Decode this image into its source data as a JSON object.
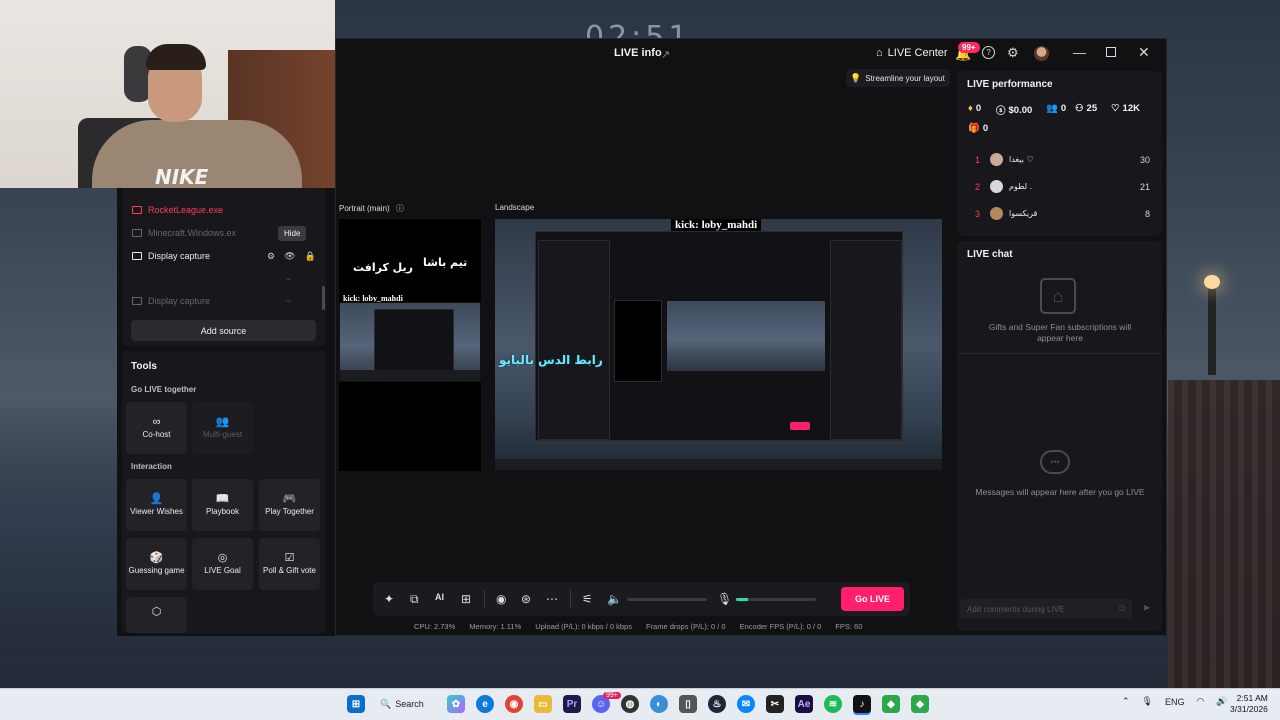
{
  "wallpaper": {
    "clock_text": "02:51"
  },
  "window": {
    "title": "LIVE info",
    "live_center_label": "LIVE Center",
    "notifications_badge": "99+",
    "tip_text": "Streamline your layout"
  },
  "sources": {
    "items": [
      {
        "label": "RocketLeague.exe",
        "state": "error"
      },
      {
        "label": "Minecraft.Windows.ex",
        "state": "hidden"
      },
      {
        "label": "Display capture",
        "state": "active"
      },
      {
        "label": "Display capture",
        "state": "hidden"
      }
    ],
    "hide_tooltip": "Hide",
    "add_source_label": "Add source"
  },
  "tools": {
    "title": "Tools",
    "go_live_together_label": "Go LIVE together",
    "cohost_label": "Co-host",
    "multiguest_label": "Multi-guest",
    "interaction_label": "Interaction",
    "viewer_wishes_label": "Viewer Wishes",
    "playbook_label": "Playbook",
    "play_together_label": "Play Together",
    "guessing_game_label": "Guessing game",
    "live_goal_label": "LIVE Goal",
    "poll_gift_label": "Poll & Gift vote"
  },
  "preview": {
    "portrait_label": "Portrait (main)",
    "landscape_label": "Landscape",
    "overlay_kick": "kick: loby_mahdi",
    "overlay_team": "تيم باشا",
    "overlay_real": "ريل كرافت",
    "overlay_link": "رابط الدس بالبايو"
  },
  "controls": {
    "go_live_label": "Go LIVE",
    "volume_level": 0,
    "mic_level": 0.15,
    "stats": {
      "cpu": "CPU:  2.73%",
      "memory": "Memory:  1.11%",
      "upload": "Upload (P/L):  0 kbps / 0 kbps",
      "frame_drops": "Frame drops (P/L):  0 / 0",
      "encoder_fps": "Encoder FPS (P/L):  0 / 0",
      "fps": "FPS:  60"
    }
  },
  "performance": {
    "title": "LIVE performance",
    "diamonds": "0",
    "earnings": "$0.00",
    "viewers": "0",
    "new_followers": "25",
    "likes": "12K",
    "gifts": "0",
    "ranking": [
      {
        "rank": "1",
        "name": "بيغدا ♡",
        "score": "30",
        "color": "#c9a99a"
      },
      {
        "rank": "2",
        "name": "لطوم .",
        "score": "21",
        "color": "#d8d8dc"
      },
      {
        "rank": "3",
        "name": "قريكسوا",
        "score": "8",
        "color": "#b08a5a"
      }
    ]
  },
  "chat": {
    "title": "LIVE chat",
    "gifts_message": "Gifts and Super Fan subscriptions will appear here",
    "empty_message": "Messages will appear here after you go LIVE",
    "input_placeholder": "Add comments during LIVE"
  },
  "taskbar": {
    "search_label": "Search",
    "discord_badge": "99+",
    "language": "ENG",
    "time": "2:51 AM",
    "date": "3/31/2026"
  }
}
